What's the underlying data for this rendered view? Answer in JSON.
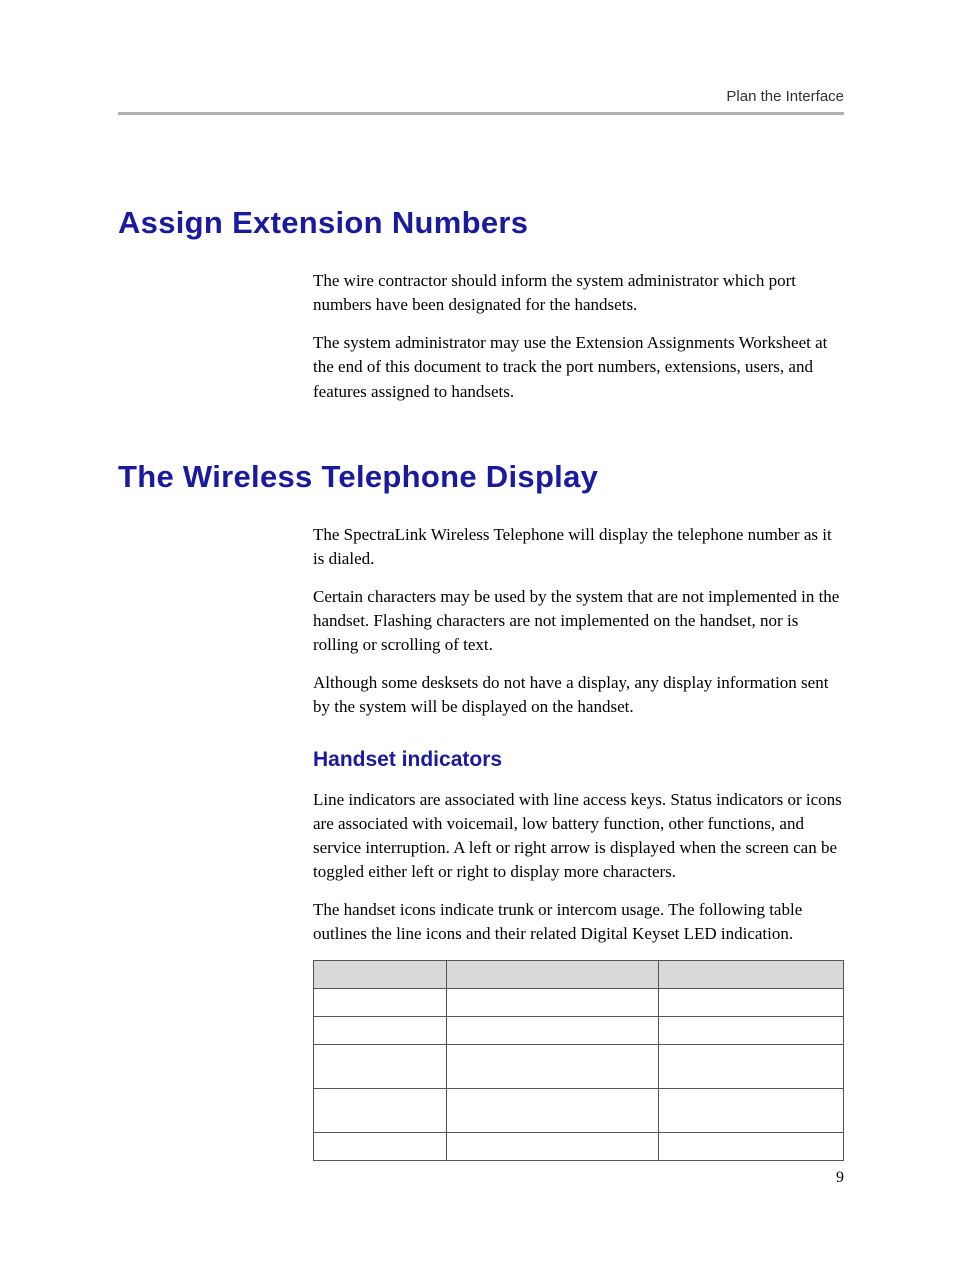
{
  "header": {
    "breadcrumb": "Plan the Interface"
  },
  "section1": {
    "title": "Assign Extension Numbers",
    "p1": "The wire contractor should inform the system administrator which port numbers have been designated for the handsets.",
    "p2": "The system administrator may use the Extension Assignments Worksheet at the end of this document to track the port numbers, extensions, users, and features assigned to handsets."
  },
  "section2": {
    "title": "The Wireless Telephone Display",
    "p1": "The SpectraLink Wireless Telephone will display the telephone number as it is dialed.",
    "p2": " Certain characters may be used by the system that are not implemented in the handset. Flashing characters are not implemented on the handset, nor is rolling or scrolling of text.",
    "p3": "Although some desksets do not have a display, any display information sent by the system will be displayed on the handset.",
    "subsection": {
      "title": "Handset indicators",
      "p1": "Line indicators are associated with line access keys. Status indicators or icons are associated with voicemail, low battery function, other functions, and service interruption. A left or right arrow is displayed when the screen can be toggled either left or right to display more characters.",
      "p2": "The handset icons indicate trunk or intercom usage. The following table outlines the line icons and their related Digital Keyset LED indication."
    }
  },
  "footer": {
    "page_number": "9"
  }
}
